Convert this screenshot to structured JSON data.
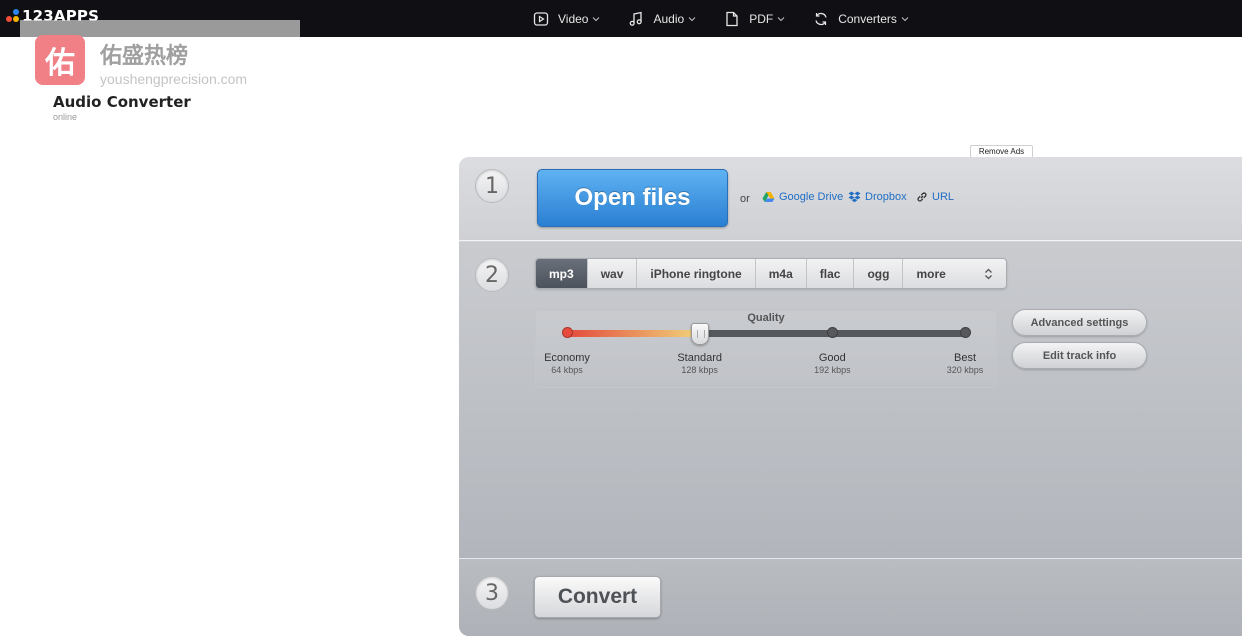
{
  "header": {
    "logo_text": "123APPS",
    "nav": [
      {
        "label": "Video",
        "icon": "video-icon"
      },
      {
        "label": "Audio",
        "icon": "music-note-icon"
      },
      {
        "label": "PDF",
        "icon": "document-icon"
      },
      {
        "label": "Converters",
        "icon": "refresh-icon"
      }
    ]
  },
  "watermark": {
    "badge_char": "佑",
    "title": "佑盛热榜",
    "subtitle": "youshengprecision.com"
  },
  "app": {
    "title": "Audio Converter",
    "subtitle": "online",
    "remove_ads": "Remove Ads"
  },
  "step1": {
    "number": "1",
    "open_label": "Open files",
    "or_label": "or",
    "sources": [
      {
        "label": "Google Drive",
        "icon": "google-drive-icon"
      },
      {
        "label": "Dropbox",
        "icon": "dropbox-icon"
      },
      {
        "label": "URL",
        "icon": "link-icon"
      }
    ]
  },
  "step2": {
    "number": "2",
    "formats": [
      "mp3",
      "wav",
      "iPhone ringtone",
      "m4a",
      "flac",
      "ogg"
    ],
    "more_label": "more",
    "selected_format": "mp3",
    "quality": {
      "label": "Quality",
      "selected_index": 1,
      "levels": [
        {
          "name": "Economy",
          "rate": "64 kbps"
        },
        {
          "name": "Standard",
          "rate": "128 kbps"
        },
        {
          "name": "Good",
          "rate": "192 kbps"
        },
        {
          "name": "Best",
          "rate": "320 kbps"
        }
      ]
    },
    "advanced_settings": "Advanced settings",
    "edit_track_info": "Edit track info"
  },
  "step3": {
    "number": "3",
    "convert_label": "Convert"
  },
  "colors": {
    "topbar": "#101014",
    "primary_button": "#3d90de",
    "link": "#1f6ec4",
    "active_tab": "#5a6069",
    "logo_dot_red": "#f04e37",
    "logo_dot_yellow": "#f5b400",
    "logo_dot_blue": "#2b86f2"
  }
}
